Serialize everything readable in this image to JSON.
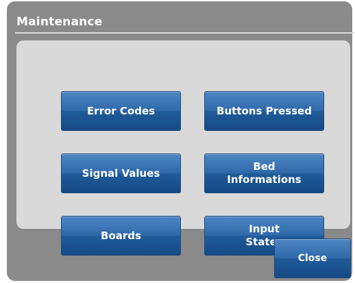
{
  "dialog": {
    "title": "Maintenance"
  },
  "buttons": {
    "error_codes": "Error Codes",
    "buttons_pressed": "Buttons Pressed",
    "signal_values": "Signal Values",
    "bed_informations": "Bed\nInformations",
    "boards": "Boards",
    "input_states": "Input\nStates"
  },
  "footer": {
    "close_label": "Close"
  },
  "colors": {
    "dialog_bg": "#8a8a8a",
    "panel_bg": "#d9d9d9",
    "button_blue": "#2f6aab"
  }
}
